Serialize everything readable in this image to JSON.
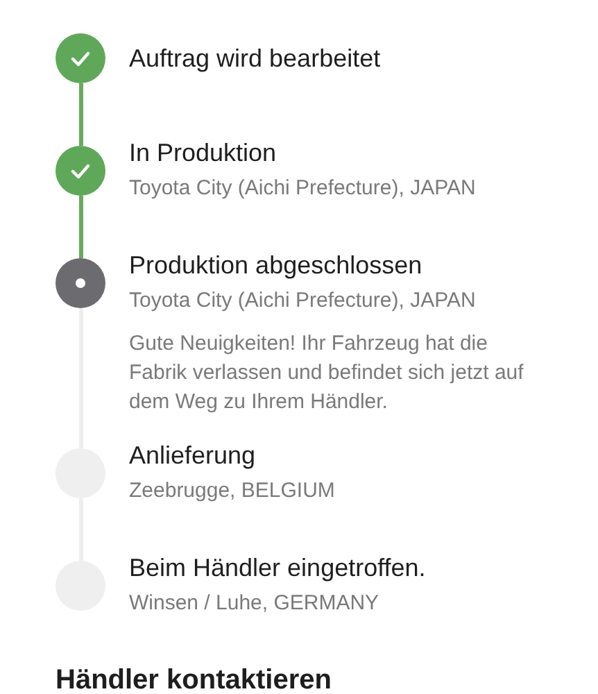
{
  "steps": [
    {
      "title": "Auftrag wird bearbeitet",
      "completed": true,
      "current": false
    },
    {
      "title": "In Produktion",
      "location": "Toyota City (Aichi Prefecture), JAPAN",
      "completed": true,
      "current": false
    },
    {
      "title": "Produktion abgeschlossen",
      "location": "Toyota City (Aichi Prefecture), JAPAN",
      "completed": false,
      "current": true,
      "message": "Gute Neuigkeiten! Ihr Fahrzeug hat die Fabrik verlassen und befindet sich jetzt auf dem Weg zu Ihrem Händler."
    },
    {
      "title": "Anlieferung",
      "location": "Zeebrugge, BELGIUM",
      "completed": false,
      "current": false
    },
    {
      "title": "Beim Händler eingetroffen.",
      "location": "Winsen / Luhe, GERMANY",
      "completed": false,
      "current": false
    }
  ],
  "contact_heading": "Händler kontaktieren"
}
